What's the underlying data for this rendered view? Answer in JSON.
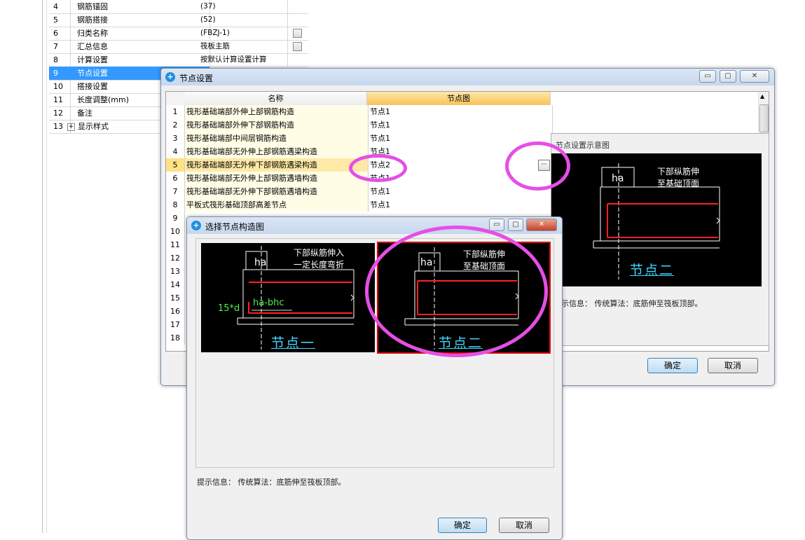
{
  "prop_table": {
    "rows": [
      {
        "num": "4",
        "name": "钢筋锚固",
        "value": "(37)",
        "check": false
      },
      {
        "num": "5",
        "name": "钢筋搭接",
        "value": "(52)",
        "check": false
      },
      {
        "num": "6",
        "name": "归类名称",
        "value": "(FBZJ-1)",
        "check": true
      },
      {
        "num": "7",
        "name": "汇总信息",
        "value": "筏板主筋",
        "check": true
      },
      {
        "num": "8",
        "name": "计算设置",
        "value": "按默认计算设置计算",
        "check": false
      },
      {
        "num": "9",
        "name": "节点设置",
        "value": "",
        "check": false
      },
      {
        "num": "10",
        "name": "搭接设置",
        "value": "",
        "check": false
      },
      {
        "num": "11",
        "name": "长度调整(mm)",
        "value": "",
        "check": false
      },
      {
        "num": "12",
        "name": "备注",
        "value": "",
        "check": false
      },
      {
        "num": "13",
        "name": "显示样式",
        "value": "",
        "check": false
      }
    ],
    "expand_symbol": "+"
  },
  "node_dialog": {
    "title": "节点设置",
    "col_name": "名称",
    "col_diagram": "节点图",
    "rows": [
      {
        "num": "1",
        "name": "筏形基础端部外伸上部钢筋构造",
        "value": "节点1"
      },
      {
        "num": "2",
        "name": "筏形基础端部外伸下部钢筋构造",
        "value": "节点1"
      },
      {
        "num": "3",
        "name": "筏形基础端部中间层钢筋构造",
        "value": "节点1"
      },
      {
        "num": "4",
        "name": "筏形基础端部无外伸上部钢筋遇梁构造",
        "value": "节点1"
      },
      {
        "num": "5",
        "name": "筏形基础端部无外伸下部钢筋遇梁构造",
        "value": "节点2"
      },
      {
        "num": "6",
        "name": "筏形基础端部无外伸上部钢筋遇墙构造",
        "value": "节点1"
      },
      {
        "num": "7",
        "name": "筏形基础端部无外伸下部钢筋遇墙构造",
        "value": "节点1"
      },
      {
        "num": "8",
        "name": "平板式筏形基础顶部高差节点",
        "value": "节点1"
      }
    ],
    "extra_row_nums": [
      "9",
      "10",
      "11",
      "12",
      "13",
      "14",
      "15",
      "16",
      "17",
      "18"
    ],
    "ellipsis_label": "···",
    "preview_title": "节点设置示意图",
    "preview_note": "下部纵筋伸\n至基础顶面",
    "preview_ha": "ha",
    "preview_node_label": "节点二",
    "hint": "示信息：  传统算法：底筋伸至筏板顶部。",
    "ok": "确定",
    "cancel": "取消",
    "win_min": "▭",
    "win_max": "▢",
    "win_close": "✕"
  },
  "select_dialog": {
    "title": "选择节点构造图",
    "option1": {
      "note": "下部纵筋伸入\n一定长度弯折",
      "ha": "ha",
      "dim1": "ha-bhc",
      "dim2": "15*d",
      "label": "节点一"
    },
    "option2": {
      "note": "下部纵筋伸\n至基础顶面",
      "ha": "ha",
      "label": "节点二"
    },
    "hint": "提示信息：  传统算法：底筋伸至筏板顶部。",
    "ok": "确定",
    "cancel": "取消",
    "win_min": "▭",
    "win_max": "▢",
    "win_close": "✕"
  },
  "colors": {
    "highlight": "#e64ee6",
    "cad_label": "#3fd6ff",
    "rebar": "#ff2020",
    "selected_frame": "#e00000"
  }
}
